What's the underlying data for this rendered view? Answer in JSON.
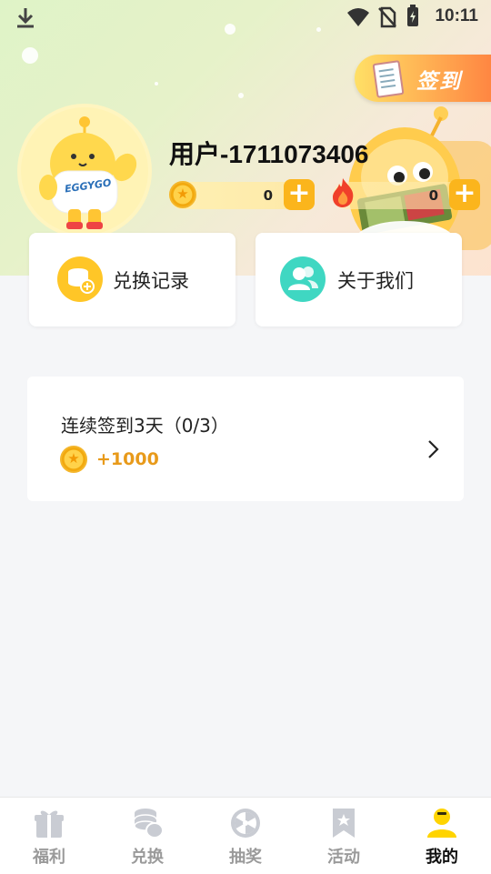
{
  "status": {
    "time": "10:11"
  },
  "header": {
    "signin_label": "签到",
    "username": "用户-1711073406",
    "coins_value": "0",
    "heat_value": "0",
    "avatar_brand": "EGGYGO"
  },
  "cards": {
    "exchange_record": "兑换记录",
    "about_us": "关于我们"
  },
  "streak": {
    "title": "连续签到3天（0/3）",
    "reward": "+1000"
  },
  "nav": {
    "tabs": [
      {
        "label": "福利",
        "icon": "gift-icon"
      },
      {
        "label": "兑换",
        "icon": "coins-stack-icon"
      },
      {
        "label": "抽奖",
        "icon": "wheel-icon"
      },
      {
        "label": "活动",
        "icon": "bookmark-star-icon"
      },
      {
        "label": "我的",
        "icon": "user-icon",
        "active": true
      }
    ]
  },
  "colors": {
    "accent": "#fbb51c",
    "reward": "#e89a1a",
    "active_user": "#ffd400"
  }
}
